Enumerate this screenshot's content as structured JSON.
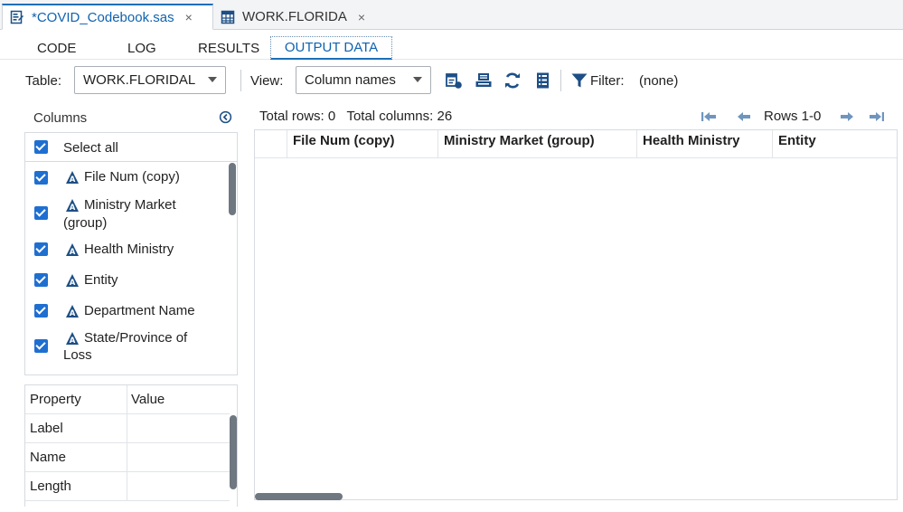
{
  "file_tabs": [
    {
      "label": "*COVID_Codebook.sas",
      "icon": "sas-program-icon"
    },
    {
      "label": "WORK.FLORIDA",
      "icon": "table-icon"
    }
  ],
  "close_glyph": "×",
  "sub_tabs": [
    "CODE",
    "LOG",
    "RESULTS",
    "OUTPUT DATA"
  ],
  "active_sub_tab": "OUTPUT DATA",
  "toolbar": {
    "table_label": "Table:",
    "table_value": "WORK.FLORIDAL",
    "view_label": "View:",
    "view_value": "Column names",
    "filter_label": "Filter:",
    "filter_value": "(none)",
    "icons": [
      "table-properties-icon",
      "export-icon",
      "refresh-icon",
      "column-list-icon",
      "filter-icon"
    ]
  },
  "columns_panel": {
    "title": "Columns",
    "select_all": "Select all",
    "items": [
      {
        "label": "File Num (copy)",
        "checked": true
      },
      {
        "label": "Ministry Market (group)",
        "line1": "Ministry Market",
        "line2": "(group)",
        "checked": true
      },
      {
        "label": "Health Ministry",
        "checked": true
      },
      {
        "label": "Entity",
        "checked": true
      },
      {
        "label": "Department Name",
        "checked": true
      },
      {
        "label": "State/Province of Loss",
        "line1": "State/Province of",
        "line2": "Loss",
        "checked": true
      }
    ]
  },
  "properties_panel": {
    "headers": [
      "Property",
      "Value"
    ],
    "rows": [
      {
        "property": "Label",
        "value": ""
      },
      {
        "property": "Name",
        "value": ""
      },
      {
        "property": "Length",
        "value": ""
      }
    ]
  },
  "grid": {
    "total_rows": "Total rows: 0",
    "total_columns": "Total columns: 26",
    "rows_range": "Rows 1-0",
    "headers": [
      "File Num (copy)",
      "Ministry Market (group)",
      "Health Ministry",
      "Entity"
    ]
  },
  "colors": {
    "accent": "#1a6fb8",
    "checkbox": "#1f6fd1",
    "icon": "#1c4f86"
  }
}
